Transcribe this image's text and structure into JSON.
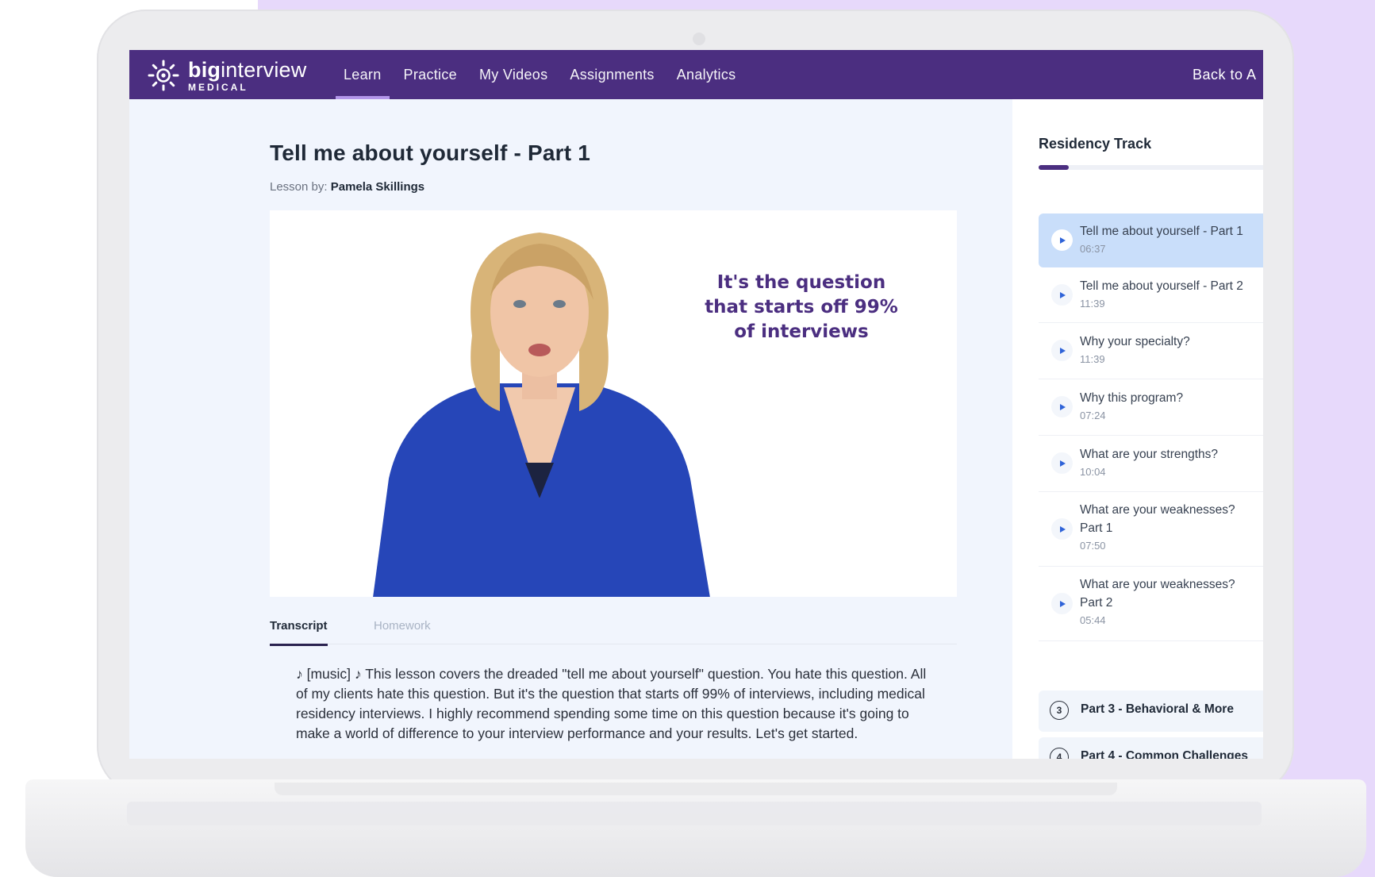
{
  "app": {
    "logo_big": "big",
    "logo_interview": "interview",
    "logo_sub": "MEDICAL",
    "brand_color": "#4b2e80"
  },
  "nav": {
    "items": [
      {
        "label": "Learn",
        "active": true
      },
      {
        "label": "Practice"
      },
      {
        "label": "My Videos"
      },
      {
        "label": "Assignments"
      },
      {
        "label": "Analytics"
      }
    ],
    "back_label": "Back to A"
  },
  "lesson": {
    "title": "Tell me about yourself - Part 1",
    "by_label": "Lesson by:",
    "author": "Pamela Skillings",
    "video_quote_line1": "It's the question",
    "video_quote_line2": "that starts off 99%",
    "video_quote_line3": "of interviews"
  },
  "tabs": {
    "transcript": "Transcript",
    "homework": "Homework"
  },
  "transcript_text": "♪ [music] ♪ This lesson covers the dreaded \"tell me about yourself\" question. You hate this question. All of my clients hate this question. But it's the question that starts off 99% of interviews, including medical residency interviews. I highly recommend spending some time on this question because it's going to make a world of difference to your interview performance and your results. Let's get started.",
  "sidebar": {
    "track_title": "Residency Track",
    "progress": 0.125,
    "lessons": [
      {
        "title": "Tell me about yourself - Part 1",
        "duration": "06:37",
        "active": true
      },
      {
        "title": "Tell me about yourself - Part 2",
        "duration": "11:39"
      },
      {
        "title": "Why your specialty?",
        "duration": "11:39"
      },
      {
        "title": "Why this program?",
        "duration": "07:24"
      },
      {
        "title": "What are your strengths?",
        "duration": "10:04"
      },
      {
        "title": "What are your weaknesses?",
        "title2": "Part 1",
        "duration": "07:50"
      },
      {
        "title": "What are your weaknesses?",
        "title2": "Part 2",
        "duration": "05:44"
      }
    ],
    "parts": [
      {
        "num": "3",
        "title": "Part 3 - Behavioral & More"
      },
      {
        "num": "4",
        "title": "Part 4 - Common Challenges"
      }
    ]
  }
}
